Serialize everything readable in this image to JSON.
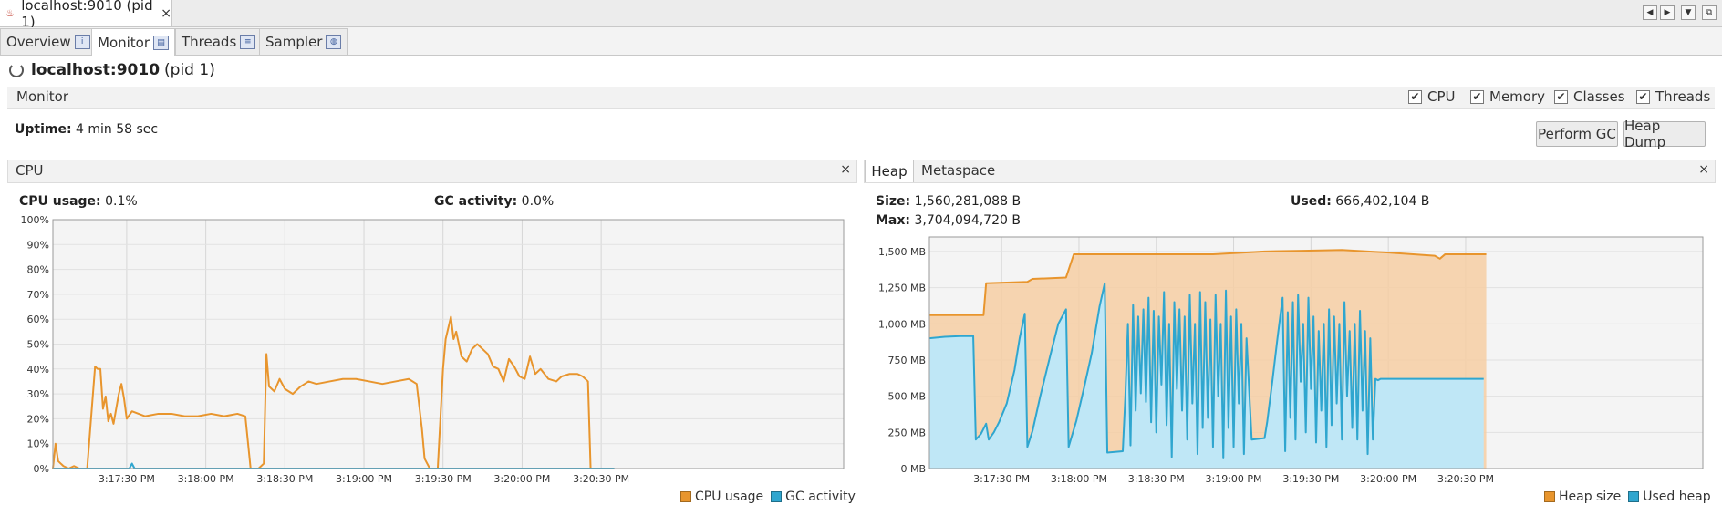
{
  "window": {
    "doc_tab_title": "localhost:9010 (pid 1)",
    "doc_tab_close": "×"
  },
  "nav_buttons": [
    "◀",
    "▶",
    "▼",
    "⧉"
  ],
  "tabs": [
    {
      "label": "Overview",
      "icon": "overview-icon",
      "glyph": "i"
    },
    {
      "label": "Monitor",
      "icon": "monitor-icon",
      "glyph": "▤"
    },
    {
      "label": "Threads",
      "icon": "threads-icon",
      "glyph": "≡"
    },
    {
      "label": "Sampler",
      "icon": "sampler-icon",
      "glyph": "◍"
    }
  ],
  "active_tab": "Monitor",
  "header": {
    "host": "localhost:9010",
    "pid": "(pid 1)"
  },
  "monitor": {
    "label": "Monitor",
    "checkboxes": [
      {
        "label": "CPU",
        "checked": true
      },
      {
        "label": "Memory",
        "checked": true
      },
      {
        "label": "Classes",
        "checked": true
      },
      {
        "label": "Threads",
        "checked": true
      }
    ],
    "check_glyph": "✔",
    "uptime_label": "Uptime:",
    "uptime_value": "4 min 58 sec",
    "perform_gc": "Perform GC",
    "heap_dump": "Heap Dump"
  },
  "cpu_panel": {
    "title": "CPU",
    "close": "×",
    "cpu_usage_label": "CPU usage:",
    "cpu_usage_value": "0.1%",
    "gc_activity_label": "GC activity:",
    "gc_activity_value": "0.0%",
    "legend": [
      {
        "label": "CPU usage",
        "color": "#e8952d"
      },
      {
        "label": "GC activity",
        "color": "#2fa6cf"
      }
    ]
  },
  "heap_panel": {
    "tabs": [
      "Heap",
      "Metaspace"
    ],
    "close": "×",
    "size_label": "Size:",
    "size_value": "1,560,281,088 B",
    "used_label": "Used:",
    "used_value": "666,402,104 B",
    "max_label": "Max:",
    "max_value": "3,704,094,720 B",
    "legend": [
      {
        "label": "Heap size",
        "color": "#e8952d"
      },
      {
        "label": "Used heap",
        "color": "#2fa6cf"
      }
    ]
  },
  "chart_data": [
    {
      "type": "line",
      "title": "CPU",
      "x_range_seconds": [
        0,
        300
      ],
      "x_ticks": [
        "3:17:30 PM",
        "3:18:00 PM",
        "3:18:30 PM",
        "3:19:00 PM",
        "3:19:30 PM",
        "3:20:00 PM",
        "3:20:30 PM"
      ],
      "x_tick_seconds": [
        28,
        58,
        88,
        118,
        148,
        178,
        208
      ],
      "y_ticks": [
        "0%",
        "10%",
        "20%",
        "30%",
        "40%",
        "50%",
        "60%",
        "70%",
        "80%",
        "90%",
        "100%"
      ],
      "ylim": [
        0,
        100
      ],
      "series": [
        {
          "name": "CPU usage",
          "color": "#e8952d",
          "points": [
            [
              0,
              0
            ],
            [
              1,
              10
            ],
            [
              2,
              3
            ],
            [
              3,
              2
            ],
            [
              4,
              1
            ],
            [
              6,
              0
            ],
            [
              8,
              1
            ],
            [
              10,
              0
            ],
            [
              13,
              0
            ],
            [
              16,
              41
            ],
            [
              17,
              40
            ],
            [
              18,
              40
            ],
            [
              19,
              24
            ],
            [
              20,
              29
            ],
            [
              21,
              19
            ],
            [
              22,
              22
            ],
            [
              23,
              18
            ],
            [
              25,
              30
            ],
            [
              26,
              34
            ],
            [
              27,
              28
            ],
            [
              28,
              20
            ],
            [
              30,
              23
            ],
            [
              35,
              21
            ],
            [
              40,
              22
            ],
            [
              45,
              22
            ],
            [
              50,
              21
            ],
            [
              55,
              21
            ],
            [
              60,
              22
            ],
            [
              65,
              21
            ],
            [
              70,
              22
            ],
            [
              73,
              21
            ],
            [
              75,
              0
            ],
            [
              78,
              0
            ],
            [
              80,
              2
            ],
            [
              81,
              46
            ],
            [
              82,
              33
            ],
            [
              84,
              31
            ],
            [
              86,
              36
            ],
            [
              88,
              32
            ],
            [
              91,
              30
            ],
            [
              94,
              33
            ],
            [
              97,
              35
            ],
            [
              100,
              34
            ],
            [
              105,
              35
            ],
            [
              110,
              36
            ],
            [
              115,
              36
            ],
            [
              120,
              35
            ],
            [
              125,
              34
            ],
            [
              130,
              35
            ],
            [
              135,
              36
            ],
            [
              138,
              34
            ],
            [
              140,
              16
            ],
            [
              141,
              4
            ],
            [
              143,
              0
            ],
            [
              146,
              0
            ],
            [
              148,
              40
            ],
            [
              149,
              52
            ],
            [
              151,
              61
            ],
            [
              152,
              52
            ],
            [
              153,
              55
            ],
            [
              155,
              45
            ],
            [
              157,
              43
            ],
            [
              159,
              48
            ],
            [
              161,
              50
            ],
            [
              163,
              48
            ],
            [
              165,
              46
            ],
            [
              167,
              41
            ],
            [
              169,
              40
            ],
            [
              171,
              35
            ],
            [
              173,
              44
            ],
            [
              175,
              41
            ],
            [
              177,
              37
            ],
            [
              179,
              36
            ],
            [
              181,
              45
            ],
            [
              183,
              38
            ],
            [
              185,
              40
            ],
            [
              188,
              36
            ],
            [
              191,
              35
            ],
            [
              193,
              37
            ],
            [
              196,
              38
            ],
            [
              199,
              38
            ],
            [
              201,
              37
            ],
            [
              203,
              35
            ],
            [
              204,
              0
            ],
            [
              206,
              0
            ],
            [
              213,
              0
            ]
          ]
        },
        {
          "name": "GC activity",
          "color": "#2fa6cf",
          "points": [
            [
              0,
              0
            ],
            [
              29,
              0
            ],
            [
              30,
              2
            ],
            [
              31,
              0
            ],
            [
              213,
              0
            ]
          ]
        }
      ]
    },
    {
      "type": "area",
      "title": "Heap",
      "x_range_seconds": [
        0,
        300
      ],
      "x_ticks": [
        "3:17:30 PM",
        "3:18:00 PM",
        "3:18:30 PM",
        "3:19:00 PM",
        "3:19:30 PM",
        "3:20:00 PM",
        "3:20:30 PM"
      ],
      "x_tick_seconds": [
        28,
        58,
        88,
        118,
        148,
        178,
        208
      ],
      "y_ticks": [
        "0 MB",
        "250 MB",
        "500 MB",
        "750 MB",
        "1,000 MB",
        "1,250 MB",
        "1,500 MB"
      ],
      "ylim": [
        0,
        1600
      ],
      "series": [
        {
          "name": "Heap size",
          "color": "#e8952d",
          "points": [
            [
              0,
              1060
            ],
            [
              21,
              1060
            ],
            [
              22,
              1280
            ],
            [
              38,
              1290
            ],
            [
              40,
              1310
            ],
            [
              53,
              1320
            ],
            [
              56,
              1480
            ],
            [
              80,
              1480
            ],
            [
              110,
              1480
            ],
            [
              130,
              1500
            ],
            [
              145,
              1505
            ],
            [
              160,
              1510
            ],
            [
              170,
              1500
            ],
            [
              180,
              1490
            ],
            [
              196,
              1470
            ],
            [
              198,
              1450
            ],
            [
              200,
              1480
            ],
            [
              216,
              1480
            ]
          ]
        },
        {
          "name": "Used heap",
          "color": "#2fa6cf",
          "points": [
            [
              0,
              900
            ],
            [
              6,
              910
            ],
            [
              12,
              915
            ],
            [
              17,
              915
            ],
            [
              18,
              200
            ],
            [
              20,
              240
            ],
            [
              22,
              310
            ],
            [
              23,
              200
            ],
            [
              25,
              250
            ],
            [
              27,
              320
            ],
            [
              30,
              450
            ],
            [
              33,
              680
            ],
            [
              35,
              900
            ],
            [
              37,
              1070
            ],
            [
              38,
              150
            ],
            [
              40,
              260
            ],
            [
              43,
              500
            ],
            [
              47,
              790
            ],
            [
              50,
              1000
            ],
            [
              53,
              1100
            ],
            [
              54,
              150
            ],
            [
              57,
              330
            ],
            [
              60,
              560
            ],
            [
              63,
              800
            ],
            [
              66,
              1120
            ],
            [
              68,
              1280
            ],
            [
              69,
              110
            ],
            [
              75,
              120
            ],
            [
              76,
              500
            ],
            [
              77,
              1000
            ],
            [
              78,
              160
            ],
            [
              79,
              1130
            ],
            [
              80,
              400
            ],
            [
              81,
              1050
            ],
            [
              82,
              520
            ],
            [
              83,
              1100
            ],
            [
              84,
              460
            ],
            [
              85,
              1180
            ],
            [
              86,
              320
            ],
            [
              87,
              1090
            ],
            [
              88,
              250
            ],
            [
              89,
              1050
            ],
            [
              90,
              580
            ],
            [
              91,
              1220
            ],
            [
              92,
              300
            ],
            [
              93,
              1000
            ],
            [
              94,
              80
            ],
            [
              95,
              1150
            ],
            [
              96,
              550
            ],
            [
              97,
              1100
            ],
            [
              98,
              400
            ],
            [
              99,
              1050
            ],
            [
              100,
              200
            ],
            [
              101,
              1200
            ],
            [
              102,
              450
            ],
            [
              103,
              1000
            ],
            [
              104,
              100
            ],
            [
              105,
              1220
            ],
            [
              106,
              280
            ],
            [
              107,
              1150
            ],
            [
              108,
              350
            ],
            [
              109,
              1030
            ],
            [
              110,
              150
            ],
            [
              111,
              1200
            ],
            [
              112,
              500
            ],
            [
              113,
              1000
            ],
            [
              114,
              70
            ],
            [
              115,
              1230
            ],
            [
              116,
              280
            ],
            [
              117,
              1050
            ],
            [
              118,
              150
            ],
            [
              119,
              1100
            ],
            [
              120,
              450
            ],
            [
              121,
              1000
            ],
            [
              122,
              100
            ],
            [
              123,
              900
            ],
            [
              125,
              200
            ],
            [
              130,
              210
            ],
            [
              131,
              320
            ],
            [
              133,
              600
            ],
            [
              135,
              900
            ],
            [
              137,
              1180
            ],
            [
              138,
              120
            ],
            [
              139,
              1080
            ],
            [
              140,
              350
            ],
            [
              141,
              1150
            ],
            [
              142,
              200
            ],
            [
              143,
              1200
            ],
            [
              144,
              600
            ],
            [
              145,
              1000
            ],
            [
              146,
              250
            ],
            [
              147,
              1180
            ],
            [
              148,
              550
            ],
            [
              149,
              1050
            ],
            [
              150,
              180
            ],
            [
              151,
              950
            ],
            [
              152,
              400
            ],
            [
              153,
              1000
            ],
            [
              154,
              150
            ],
            [
              155,
              1100
            ],
            [
              156,
              300
            ],
            [
              157,
              1050
            ],
            [
              158,
              450
            ],
            [
              159,
              1000
            ],
            [
              160,
              200
            ],
            [
              161,
              1150
            ],
            [
              162,
              500
            ],
            [
              163,
              950
            ],
            [
              164,
              280
            ],
            [
              165,
              1000
            ],
            [
              166,
              200
            ],
            [
              167,
              1090
            ],
            [
              168,
              400
            ],
            [
              169,
              950
            ],
            [
              170,
              100
            ],
            [
              171,
              900
            ],
            [
              172,
              200
            ],
            [
              173,
              620
            ],
            [
              174,
              610
            ],
            [
              175,
              620
            ],
            [
              215,
              620
            ]
          ]
        }
      ]
    }
  ]
}
